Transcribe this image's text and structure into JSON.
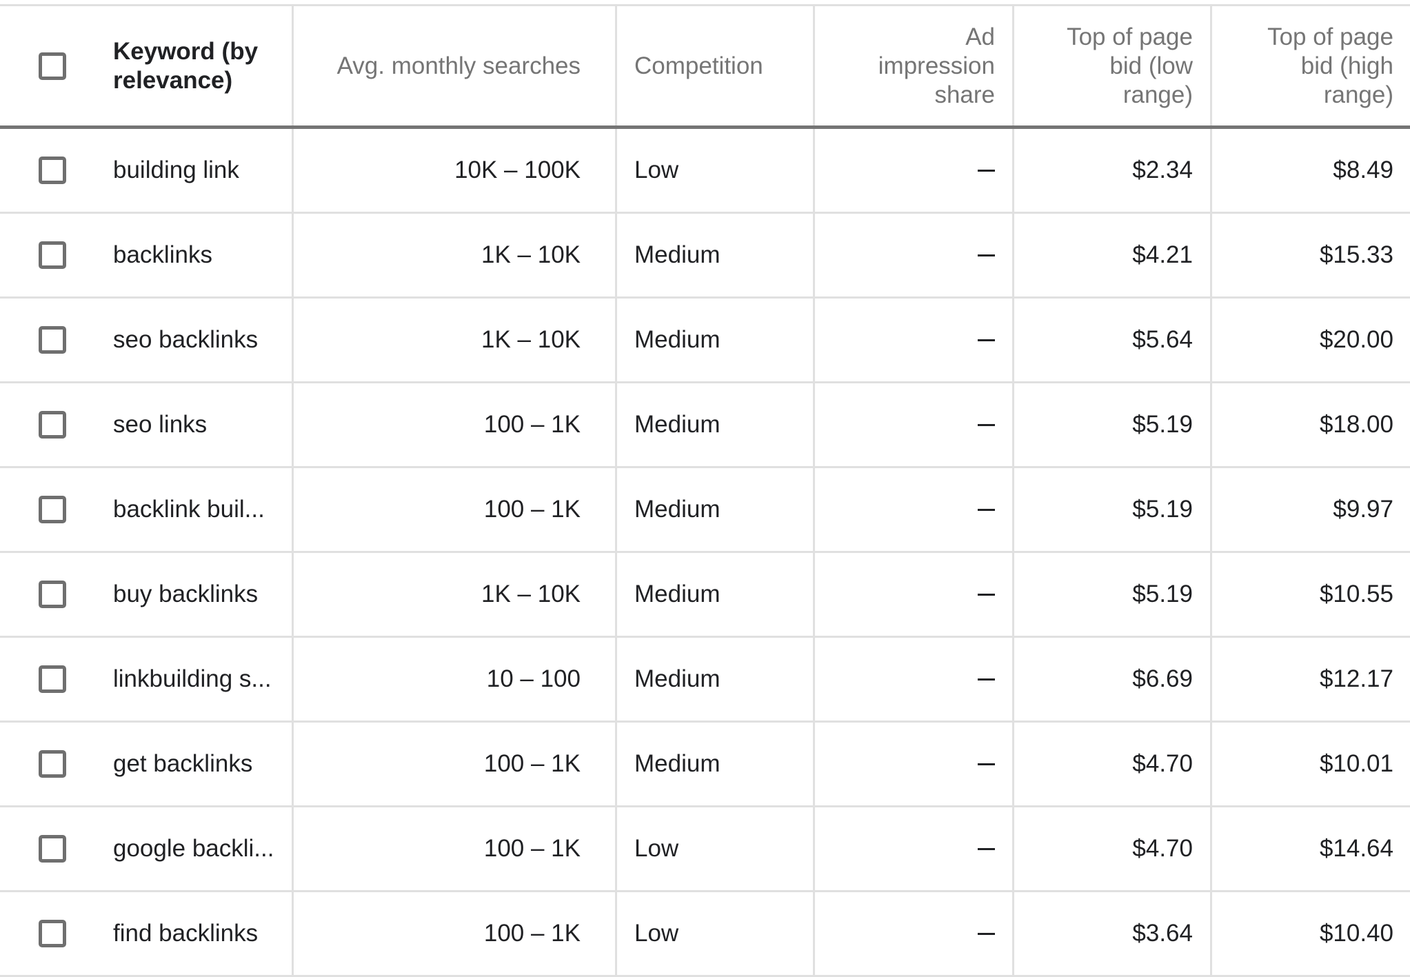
{
  "table": {
    "headers": {
      "keyword": "Keyword (by relevance)",
      "avg_monthly_searches": "Avg. monthly searches",
      "competition": "Competition",
      "ad_impression_share": "Ad impression share",
      "top_bid_low": "Top of page bid (low range)",
      "top_bid_high": "Top of page bid (high range)"
    },
    "select_all_checked": false,
    "rows": [
      {
        "keyword": "building link",
        "searches": "10K – 100K",
        "competition": "Low",
        "impression_share": "—",
        "bid_low": "$2.34",
        "bid_high": "$8.49",
        "checked": false
      },
      {
        "keyword": "backlinks",
        "searches": "1K – 10K",
        "competition": "Medium",
        "impression_share": "—",
        "bid_low": "$4.21",
        "bid_high": "$15.33",
        "checked": false
      },
      {
        "keyword": "seo backlinks",
        "searches": "1K – 10K",
        "competition": "Medium",
        "impression_share": "—",
        "bid_low": "$5.64",
        "bid_high": "$20.00",
        "checked": false
      },
      {
        "keyword": "seo links",
        "searches": "100 – 1K",
        "competition": "Medium",
        "impression_share": "—",
        "bid_low": "$5.19",
        "bid_high": "$18.00",
        "checked": false
      },
      {
        "keyword": "backlink buil...",
        "searches": "100 – 1K",
        "competition": "Medium",
        "impression_share": "—",
        "bid_low": "$5.19",
        "bid_high": "$9.97",
        "checked": false
      },
      {
        "keyword": "buy backlinks",
        "searches": "1K – 10K",
        "competition": "Medium",
        "impression_share": "—",
        "bid_low": "$5.19",
        "bid_high": "$10.55",
        "checked": false
      },
      {
        "keyword": "linkbuilding s...",
        "searches": "10 – 100",
        "competition": "Medium",
        "impression_share": "—",
        "bid_low": "$6.69",
        "bid_high": "$12.17",
        "checked": false
      },
      {
        "keyword": "get backlinks",
        "searches": "100 – 1K",
        "competition": "Medium",
        "impression_share": "—",
        "bid_low": "$4.70",
        "bid_high": "$10.01",
        "checked": false
      },
      {
        "keyword": "google backli...",
        "searches": "100 – 1K",
        "competition": "Low",
        "impression_share": "—",
        "bid_low": "$4.70",
        "bid_high": "$14.64",
        "checked": false
      },
      {
        "keyword": "find backlinks",
        "searches": "100 – 1K",
        "competition": "Low",
        "impression_share": "—",
        "bid_low": "$3.64",
        "bid_high": "$10.40",
        "checked": false
      }
    ]
  }
}
